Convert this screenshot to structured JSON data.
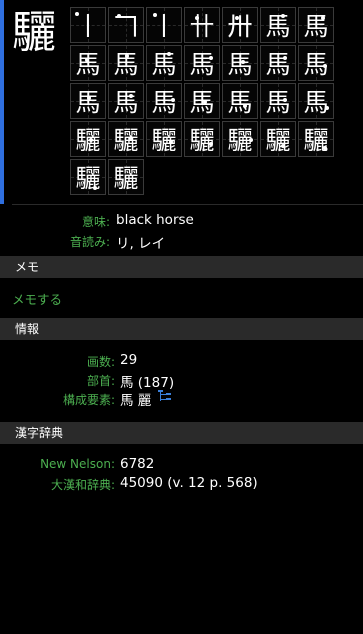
{
  "kanji": "驪",
  "accent_color": "#2f6fe0",
  "label_color": "#4caf50",
  "stroke_order": {
    "glyphs": [
      "丨",
      "𠃍",
      "丨",
      "卄",
      "卅",
      "馬",
      "馬",
      "馬",
      "馬",
      "馬",
      "馬",
      "馬",
      "馬",
      "馬",
      "馬",
      "馬",
      "馬",
      "馬",
      "馬",
      "馬",
      "馬",
      "驪",
      "驪",
      "驪",
      "驪",
      "驪",
      "驪",
      "驪",
      "驪",
      "驪"
    ]
  },
  "info_top": {
    "meaning_label": "意味:",
    "meaning_value": "black horse",
    "on_label": "音読み:",
    "on_value": "リ, レイ"
  },
  "memo": {
    "header": "メモ",
    "add_link": "メモする"
  },
  "info": {
    "header": "情報",
    "strokes_label": "画数:",
    "strokes_value": "29",
    "radical_label": "部首:",
    "radical_value": "馬 (187)",
    "components_label": "構成要素:",
    "components_value": "馬 麗",
    "components_icon": "component-tree-icon"
  },
  "dictionary": {
    "header": "漢字辞典",
    "nelson_label": "New Nelson:",
    "nelson_value": "6782",
    "daikanwa_label": "大漢和辞典:",
    "daikanwa_value": "45090 (v. 12 p. 568)"
  }
}
